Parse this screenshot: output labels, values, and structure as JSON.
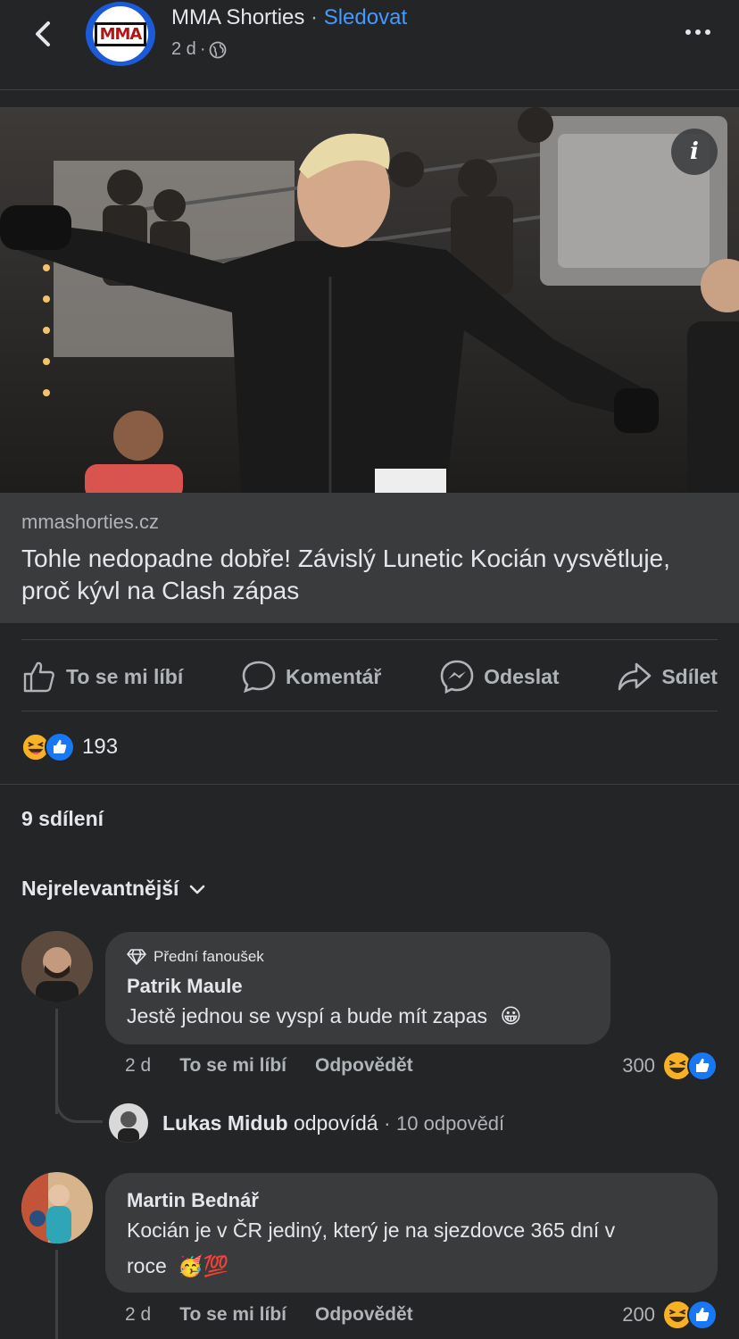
{
  "header": {
    "page_name": "MMA Shorties",
    "separator": " · ",
    "follow_label": "Sledovat",
    "post_time": "2 d",
    "meta_separator": "·",
    "logo_text": "MMA",
    "back_icon": "chevron-left-icon",
    "more_icon": "more-horizontal-icon",
    "privacy_icon": "globe-icon"
  },
  "photo": {
    "info_label": "i"
  },
  "link_preview": {
    "domain": "mmashorties.cz",
    "title": "Tohle nedopadne dobře! Závislý Lunetic Kocián vysvětluje, proč kývl na Clash zápas"
  },
  "actions": {
    "like": "To se mi líbí",
    "comment": "Komentář",
    "send": "Odeslat",
    "share": "Sdílet"
  },
  "stats": {
    "reaction_count": "193",
    "shares": "9 sdílení"
  },
  "sort": {
    "label": "Nejrelevantnější"
  },
  "comments": [
    {
      "badge": "Přední fanoušek",
      "name": "Patrik Maule",
      "text": "Jestě jednou se vyspí a bude mít zapas",
      "emoji": "😀",
      "time": "2 d",
      "like_label": "To se mi líbí",
      "reply_label": "Odpovědět",
      "reaction_count": "300",
      "reply_preview": {
        "name": "Lukas Midub",
        "action": " odpovídá",
        "sep": " · ",
        "count": "10 odpovědí"
      }
    },
    {
      "name": "Martin Bednář",
      "text_line1": "Kocián je v ČR jediný, který je na sjezdovce 365 dní v",
      "text_line2": "roce",
      "emoji": "🥳💯",
      "time": "2 d",
      "like_label": "To se mi líbí",
      "reply_label": "Odpovědět",
      "reaction_count": "200"
    }
  ],
  "colors": {
    "background": "#242526",
    "surface": "#3a3b3c",
    "accent": "#4599ff",
    "like_blue": "#1877f2",
    "haha_yellow": "#f7b125"
  }
}
